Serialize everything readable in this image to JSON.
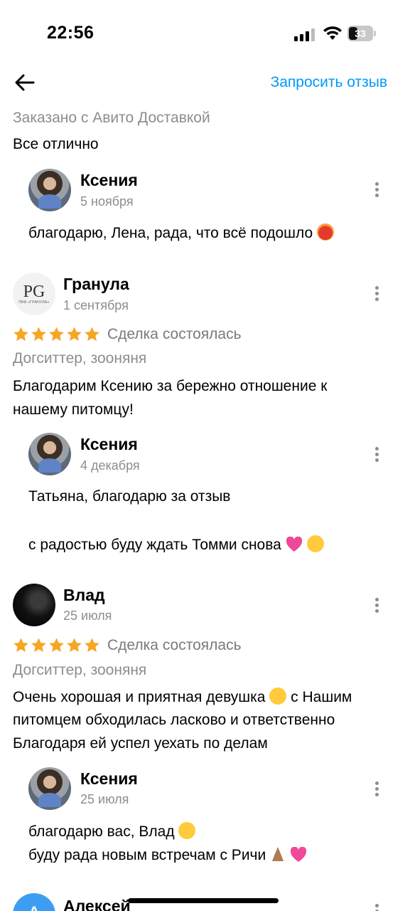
{
  "status_bar": {
    "time": "22:56",
    "battery": "33"
  },
  "header": {
    "request_review_label": "Запросить отзыв"
  },
  "top_review": {
    "delivery_note": "Заказано с Авито Доставкой",
    "text": "Все отлично",
    "reply": {
      "name": "Ксения",
      "date": "5 ноября",
      "text": "благодарю, Лена, рада, что всё подошло"
    }
  },
  "reviews": [
    {
      "name": "Гранула",
      "date": "1 сентября",
      "avatar_text": "PG",
      "avatar_subtext": "ПКФ «ГРАНУЛА»",
      "rating": 5,
      "deal_status": "Сделка состоялась",
      "category": "Догситтер, зооняня",
      "text_lines": [
        "Благодарим Ксению за бережно отношение к",
        "нашему питомцу!"
      ],
      "reply": {
        "name": "Ксения",
        "date": "4 декабря",
        "line1": "Татьяна, благодарю за отзыв",
        "line2": "с радостью буду ждать Томми снова"
      }
    },
    {
      "name": "Влад",
      "date": "25 июля",
      "rating": 5,
      "deal_status": "Сделка состоялась",
      "category": "Догситтер, зооняня",
      "text_lines": [
        "Очень хорошая и приятная девушка",
        "с Нашим",
        "питомцем обходилась ласково и ответственно",
        "Благодаря ей успел уехать по делам"
      ],
      "reply": {
        "name": "Ксения",
        "date": "25 июля",
        "line1": "благодарю вас, Влад",
        "line2": "буду рада новым встречам с Ричи"
      }
    },
    {
      "name": "Алексей",
      "avatar_letter": "А"
    }
  ],
  "colors": {
    "accent": "#0099f7",
    "star": "#f5a623",
    "muted": "#8d8d8d"
  },
  "icons": [
    "back-arrow-icon",
    "more-vertical-icon",
    "star-icon",
    "signal-icon",
    "wifi-icon",
    "battery-icon"
  ]
}
